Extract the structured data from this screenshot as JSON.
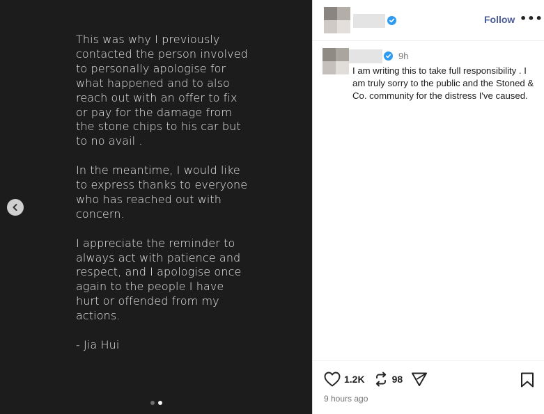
{
  "slide": {
    "paragraphs": [
      "This was why I previously contacted the person involved to personally apologise for what happened and to also reach out with an offer to fix or pay for the damage from the stone chips to his car but to no avail .",
      "In the meantime, I would like to express thanks to everyone who has reached out with concern.",
      "I appreciate the reminder to always act with patience and respect, and I apologise once again to the people I have hurt or offended from my actions."
    ],
    "signature": "- Jia Hui",
    "pagination": {
      "total": 2,
      "current": 2
    },
    "prev_icon": "chevron-left-icon"
  },
  "header": {
    "follow_label": "Follow",
    "more_label": "•••",
    "avatar_colors": [
      "#8a8580",
      "#b3aea8",
      "#cfcac5",
      "#e3dfdb"
    ]
  },
  "comment": {
    "time": "9h",
    "text": "I am writing this to take full responsibility . I am truly sorry to the public and the Stoned & Co. community for the distress I've caused.",
    "avatar_colors": [
      "#8f8a84",
      "#aaa59f",
      "#c5c0bb",
      "#e1ddd9"
    ]
  },
  "footer": {
    "likes": "1.2K",
    "reposts": "98",
    "timestamp": "9 hours ago"
  },
  "colors": {
    "verified": "#2f9bf0",
    "follow": "#4a5b9a",
    "media_bg": "#1c1c1c"
  }
}
